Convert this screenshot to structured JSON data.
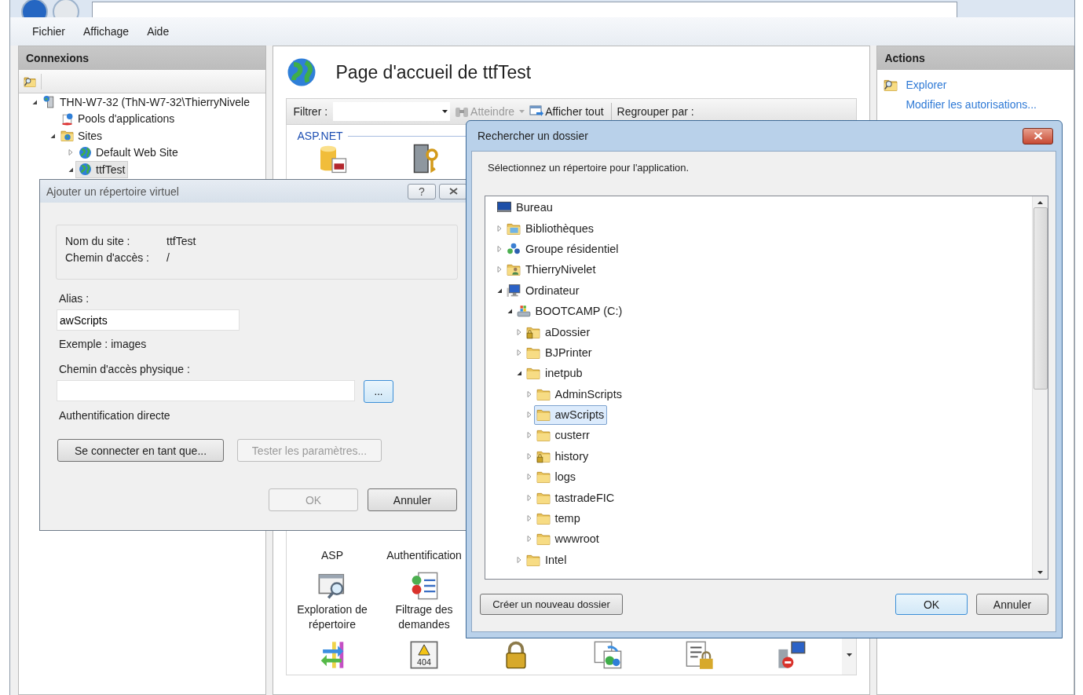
{
  "window": {
    "menu": [
      {
        "label": "Fichier"
      },
      {
        "label": "Affichage"
      },
      {
        "label": "Aide"
      }
    ]
  },
  "connections": {
    "title": "Connexions",
    "tree": [
      {
        "label": "THN-W7-32 (ThN-W7-32\\ThierryNivele",
        "kind": "server",
        "expanded": true,
        "selected": false,
        "children": [
          {
            "label": "Pools d'applications",
            "kind": "app-pool",
            "selected": false
          },
          {
            "label": "Sites",
            "kind": "sites",
            "expanded": true,
            "selected": false,
            "children": [
              {
                "label": "Default Web Site",
                "kind": "globe",
                "expanded": false,
                "selected": false
              },
              {
                "label": "ttfTest",
                "kind": "globe",
                "expanded": true,
                "selected": true
              }
            ]
          }
        ]
      }
    ]
  },
  "home": {
    "title": "Page d'accueil de ttfTest",
    "filter_label": "Filtrer :",
    "goto": "Atteindre",
    "show_all": "Afficher tout",
    "group_by": "Regrouper par :",
    "group": "ASP.NET",
    "top_icons": [
      {
        "kind": "database"
      },
      {
        "kind": "server-key"
      }
    ],
    "rows": [
      [
        {
          "label": "ASP"
        },
        {
          "label": "Authentification"
        }
      ],
      [
        {
          "kind": "dir-browse",
          "label": "Exploration de répertoire"
        },
        {
          "kind": "request-filter",
          "label": "Filtrage des demandes"
        }
      ],
      [
        {
          "kind": "redirect"
        },
        {
          "kind": "error-404",
          "badge": "404"
        },
        {
          "kind": "lock"
        },
        {
          "kind": "handler-mappings"
        },
        {
          "kind": "doc-lock"
        },
        {
          "kind": "server-blocked"
        }
      ]
    ]
  },
  "actions": {
    "title": "Actions",
    "items": [
      {
        "label": "Explorer",
        "kind": "explore"
      },
      {
        "label": "Modifier les autorisations..."
      }
    ]
  },
  "add_dialog": {
    "title": "Ajouter un répertoire virtuel",
    "help": "?",
    "site_label": "Nom du site :",
    "site_value": "ttfTest",
    "path_label": "Chemin d'accès :",
    "path_value": "/",
    "alias_label": "Alias :",
    "alias_value": "awScripts",
    "example": "Exemple : images",
    "physical_label": "Chemin d'accès physique :",
    "browse": "...",
    "auth": "Authentification directe",
    "buttons": [
      {
        "label": "Se connecter en tant que...",
        "disabled": false
      },
      {
        "label": "Tester les paramètres...",
        "disabled": true
      }
    ],
    "ok": {
      "label": "OK",
      "disabled": true
    },
    "cancel": {
      "label": "Annuler",
      "disabled": false
    }
  },
  "browse_dialog": {
    "title": "Rechercher un dossier",
    "prompt": "Sélectionnez un répertoire pour l'application.",
    "tree": {
      "label": "Bureau",
      "kind": "desktop",
      "selected": false,
      "children": [
        {
          "label": "Bibliothèques",
          "kind": "library",
          "expanded": false,
          "selected": false
        },
        {
          "label": "Groupe résidentiel",
          "kind": "homegroup",
          "expanded": false,
          "selected": false
        },
        {
          "label": "ThierryNivelet",
          "kind": "user",
          "expanded": false,
          "selected": false
        },
        {
          "label": "Ordinateur",
          "kind": "computer",
          "expanded": true,
          "selected": false,
          "children": [
            {
              "label": "BOOTCAMP (C:)",
              "kind": "drive",
              "expanded": true,
              "selected": false,
              "children": [
                {
                  "label": "aDossier",
                  "kind": "locked-folder",
                  "expanded": false,
                  "selected": false
                },
                {
                  "label": "BJPrinter",
                  "kind": "folder",
                  "expanded": false,
                  "selected": false
                },
                {
                  "label": "inetpub",
                  "kind": "folder",
                  "expanded": true,
                  "selected": false,
                  "children": [
                    {
                      "label": "AdminScripts",
                      "kind": "folder",
                      "expanded": false,
                      "selected": false
                    },
                    {
                      "label": "awScripts",
                      "kind": "folder",
                      "expanded": false,
                      "selected": true
                    },
                    {
                      "label": "custerr",
                      "kind": "folder",
                      "expanded": false,
                      "selected": false
                    },
                    {
                      "label": "history",
                      "kind": "locked-folder",
                      "expanded": false,
                      "selected": false
                    },
                    {
                      "label": "logs",
                      "kind": "folder",
                      "expanded": false,
                      "selected": false
                    },
                    {
                      "label": "tastradeFIC",
                      "kind": "folder",
                      "expanded": false,
                      "selected": false
                    },
                    {
                      "label": "temp",
                      "kind": "folder",
                      "expanded": false,
                      "selected": false
                    },
                    {
                      "label": "wwwroot",
                      "kind": "folder",
                      "expanded": false,
                      "selected": false
                    }
                  ]
                },
                {
                  "label": "Intel",
                  "kind": "folder",
                  "expanded": false,
                  "selected": false
                }
              ]
            }
          ]
        }
      ]
    },
    "new_folder": "Créer un nouveau dossier",
    "ok": "OK",
    "cancel": "Annuler"
  }
}
